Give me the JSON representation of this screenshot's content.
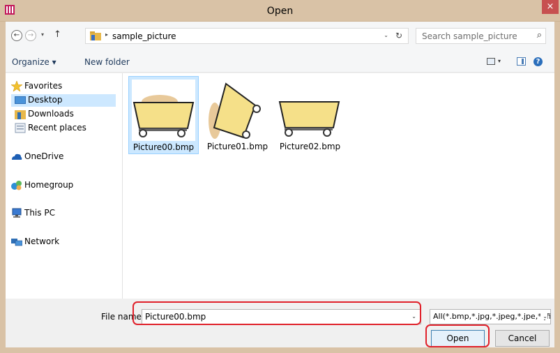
{
  "window": {
    "title": "Open",
    "close_label": "×"
  },
  "address": {
    "back_glyph": "←",
    "forward_glyph": "→",
    "recent_glyph": "▾",
    "up_glyph": "↑",
    "separator_glyph": "▸",
    "path": "sample_picture",
    "dropdown_glyph": "⌄",
    "refresh_glyph": "↻"
  },
  "search": {
    "placeholder": "Search sample_picture",
    "icon_glyph": "⌕"
  },
  "toolbar": {
    "organize_label": "Organize ▾",
    "new_folder_label": "New folder",
    "views_drop_glyph": "▾",
    "help_glyph": "?"
  },
  "nav": {
    "favorites": "Favorites",
    "desktop": "Desktop",
    "downloads": "Downloads",
    "recent_places": "Recent places",
    "onedrive": "OneDrive",
    "homegroup": "Homegroup",
    "this_pc": "This PC",
    "network": "Network"
  },
  "files": [
    {
      "name": "Picture00.bmp",
      "selected": true
    },
    {
      "name": "Picture01.bmp",
      "selected": false
    },
    {
      "name": "Picture02.bmp",
      "selected": false
    }
  ],
  "bottom": {
    "file_name_label": "File name",
    "file_name_value": "Picture00.bmp",
    "file_name_drop_glyph": "⌄",
    "filter_value": "All(*.bmp,*.jpg,*.jpeg,*.jpe,*.jfif",
    "filter_drop_glyph": "⌄",
    "open_label": "Open",
    "cancel_label": "Cancel"
  },
  "colors": {
    "title_bar": "#d9c2a6",
    "close_button": "#c75050",
    "selection": "#cce8ff",
    "highlight_annotation": "#e0202a",
    "cart_fill": "#f5e089",
    "cart_shadow": "#e8c99a"
  }
}
